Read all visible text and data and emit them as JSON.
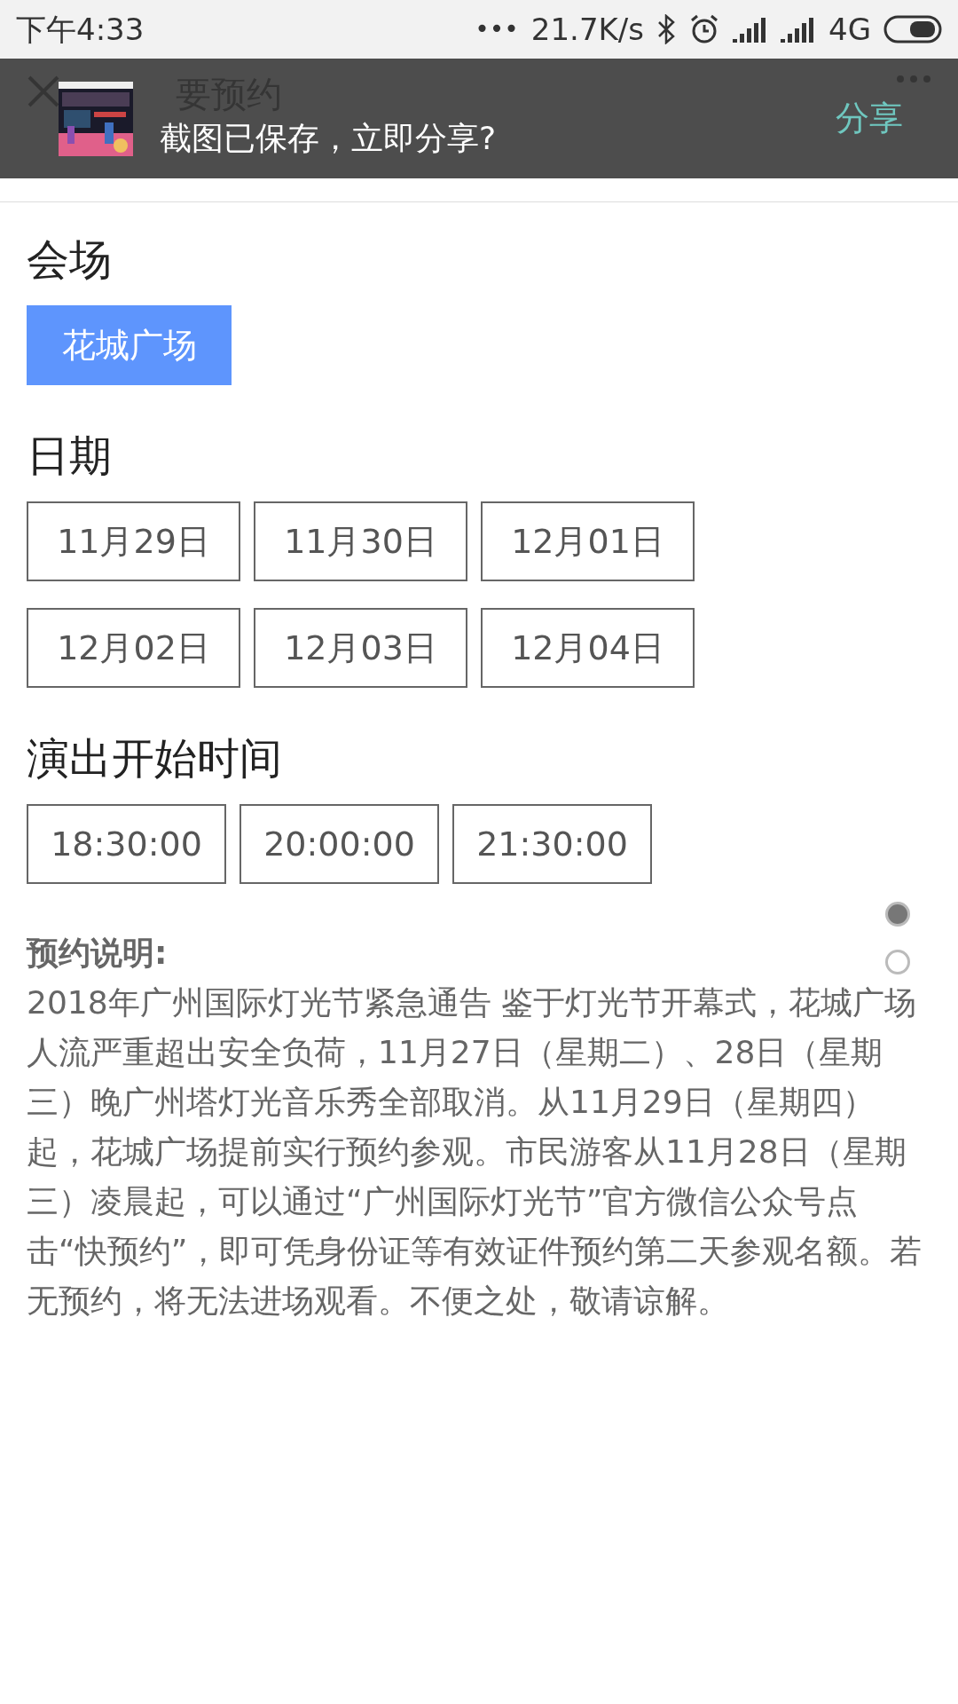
{
  "status_bar": {
    "time": "下午4:33",
    "dots": "•••",
    "speed": "21.7K/s",
    "network": "4G"
  },
  "header": {
    "title": "要预约"
  },
  "toast": {
    "message": "截图已保存，立即分享?",
    "action": "分享"
  },
  "venue": {
    "title": "会场",
    "options": [
      {
        "label": "花城广场",
        "selected": true
      }
    ]
  },
  "date": {
    "title": "日期",
    "options": [
      {
        "label": "11月29日",
        "selected": false
      },
      {
        "label": "11月30日",
        "selected": false
      },
      {
        "label": "12月01日",
        "selected": false
      },
      {
        "label": "12月02日",
        "selected": false
      },
      {
        "label": "12月03日",
        "selected": false
      },
      {
        "label": "12月04日",
        "selected": false
      }
    ]
  },
  "time": {
    "title": "演出开始时间",
    "options": [
      {
        "label": "18:30:00",
        "selected": false
      },
      {
        "label": "20:00:00",
        "selected": false
      },
      {
        "label": "21:30:00",
        "selected": false
      }
    ]
  },
  "pager_dots": [
    {
      "selected": true
    },
    {
      "selected": false
    }
  ],
  "notice": {
    "title": "预约说明:",
    "body": "2018年广州国际灯光节紧急通告 鉴于灯光节开幕式，花城广场人流严重超出安全负荷，11月27日（星期二）、28日（星期三）晚广州塔灯光音乐秀全部取消。从11月29日（星期四）起，花城广场提前实行预约参观。市民游客从11月28日（星期三）凌晨起，可以通过“广州国际灯光节”官方微信公众号点击“快预约”，即可凭身份证等有效证件预约第二天参观名额。若无预约，将无法进场观看。不便之处，敬请谅解。"
  }
}
